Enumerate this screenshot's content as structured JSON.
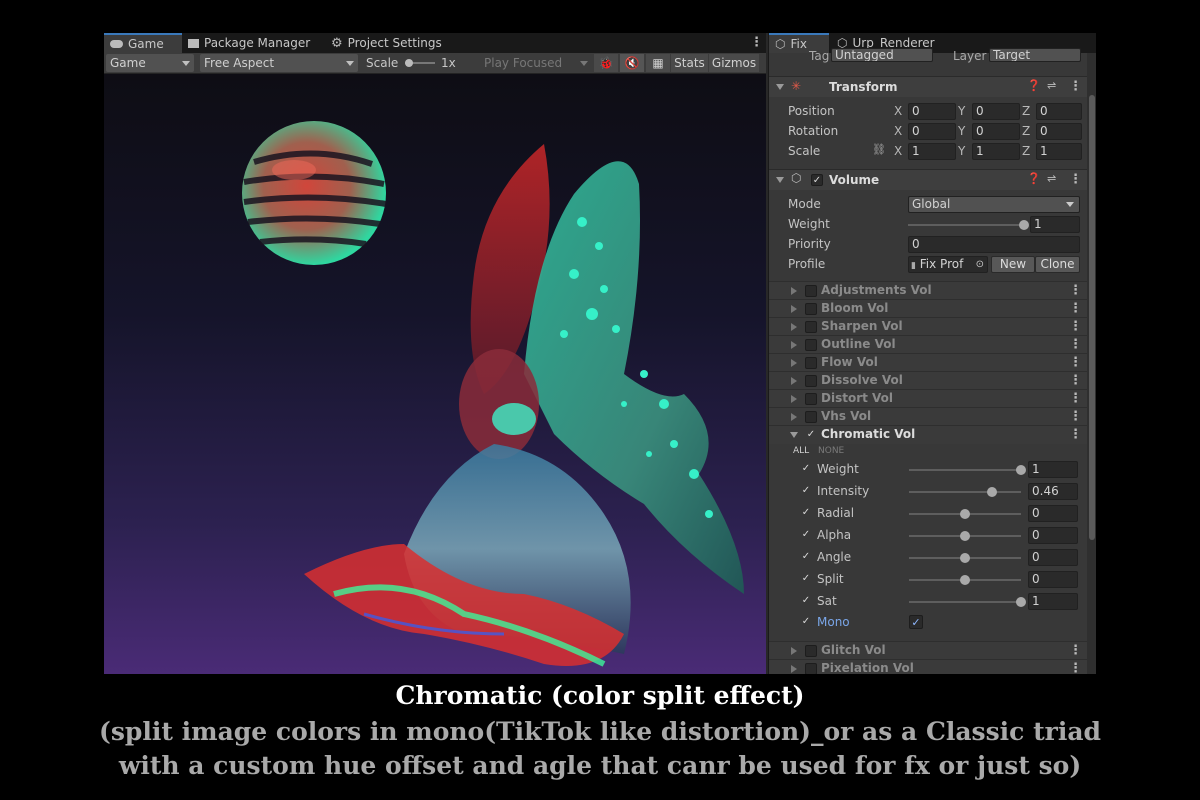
{
  "game_view": {
    "tabs": [
      {
        "label": "Game",
        "icon": "gamepad-icon"
      },
      {
        "label": "Package Manager",
        "icon": "package-icon"
      },
      {
        "label": "Project Settings",
        "icon": "gear-icon"
      }
    ],
    "toolbar": {
      "display": "Game",
      "aspect": "Free Aspect",
      "scale_label": "Scale",
      "scale_value": "1x",
      "play_mode": "Play Focused",
      "stats": "Stats",
      "gizmos": "Gizmos"
    }
  },
  "inspector": {
    "tabs": [
      {
        "label": "Fix",
        "icon": "cube-icon"
      },
      {
        "label": "Urp_Renderer",
        "icon": "cube-icon"
      }
    ],
    "tag_label": "Tag",
    "tag_value": "Untagged",
    "layer_label": "Layer",
    "layer_value": "Target",
    "transform": {
      "title": "Transform",
      "position": {
        "label": "Position",
        "x": "0",
        "y": "0",
        "z": "0"
      },
      "rotation": {
        "label": "Rotation",
        "x": "0",
        "y": "0",
        "z": "0"
      },
      "scale": {
        "label": "Scale",
        "x": "1",
        "y": "1",
        "z": "1"
      },
      "axes": {
        "x": "X",
        "y": "Y",
        "z": "Z"
      }
    },
    "volume": {
      "title": "Volume",
      "mode_label": "Mode",
      "mode_value": "Global",
      "weight_label": "Weight",
      "weight_value": "1",
      "weight_fraction": 1.0,
      "priority_label": "Priority",
      "priority_value": "0",
      "profile_label": "Profile",
      "profile_value": "Fix Prof",
      "new_button": "New",
      "clone_button": "Clone"
    },
    "collapsed_components": [
      "Adjustments Vol",
      "Bloom Vol",
      "Sharpen Vol",
      "Outline Vol",
      "Flow Vol",
      "Dissolve Vol",
      "Distort Vol",
      "Vhs Vol"
    ],
    "chromatic": {
      "title": "Chromatic Vol",
      "all_label": "ALL",
      "none_label": "NONE",
      "params": [
        {
          "label": "Weight",
          "value": "1",
          "fraction": 1.0
        },
        {
          "label": "Intensity",
          "value": "0.46",
          "fraction": 0.74
        },
        {
          "label": "Radial",
          "value": "0",
          "fraction": 0.5
        },
        {
          "label": "Alpha",
          "value": "0",
          "fraction": 0.5
        },
        {
          "label": "Angle",
          "value": "0",
          "fraction": 0.5
        },
        {
          "label": "Split",
          "value": "0",
          "fraction": 0.5
        },
        {
          "label": "Sat",
          "value": "1",
          "fraction": 1.0
        }
      ],
      "mono_label": "Mono"
    },
    "bottom_components": [
      "Glitch Vol",
      "Pixelation Vol"
    ]
  },
  "caption": {
    "line1": "Chromatic (color split effect)",
    "line2": "(split image colors in mono(TikTok like distortion)_or as a Classic triad",
    "line3": "with a custom hue offset and agle that canr be used for fx or just so)"
  }
}
